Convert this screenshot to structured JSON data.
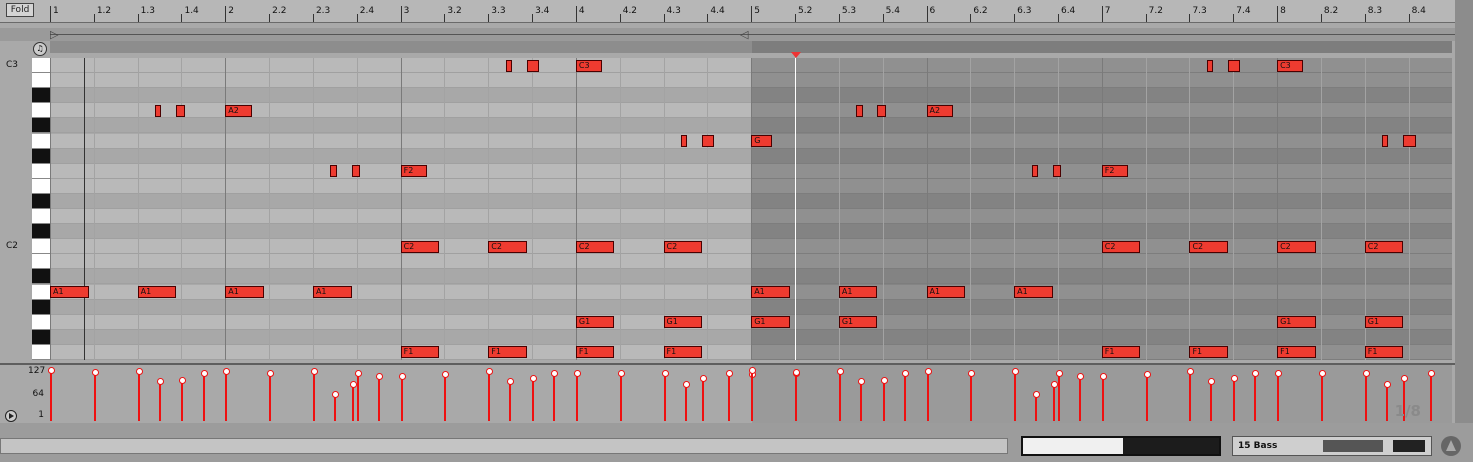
{
  "toolbar": {
    "fold_label": "Fold"
  },
  "ruler": {
    "labels": [
      "1",
      "1.2",
      "1.3",
      "1.4",
      "2",
      "2.2",
      "2.3",
      "2.4",
      "3",
      "3.2",
      "3.3",
      "3.4",
      "4",
      "4.2",
      "4.3",
      "4.4",
      "5",
      "5.2",
      "5.3",
      "5.4",
      "6",
      "6.2",
      "6.3",
      "6.4",
      "7",
      "7.2",
      "7.3",
      "7.4",
      "8",
      "8.2",
      "8.3",
      "8.4"
    ]
  },
  "piano": {
    "octave_labels": [
      "C3",
      "C2"
    ]
  },
  "velocity": {
    "axis_labels": [
      "127",
      "64",
      "1"
    ],
    "grid_label": "1/8"
  },
  "clip": {
    "playhead_beat": 4.25
  },
  "notes": [
    {
      "pitch": "C3",
      "beat": 2.6,
      "length": 0.035,
      "label": ""
    },
    {
      "pitch": "C3",
      "beat": 2.72,
      "length": 0.07,
      "label": ""
    },
    {
      "pitch": "C3",
      "beat": 3.0,
      "length": 0.15,
      "label": "C3"
    },
    {
      "pitch": "A2",
      "beat": 0.6,
      "length": 0.035,
      "label": ""
    },
    {
      "pitch": "A2",
      "beat": 0.72,
      "length": 0.05,
      "label": ""
    },
    {
      "pitch": "A2",
      "beat": 1.0,
      "length": 0.15,
      "label": "A2"
    },
    {
      "pitch": "G2",
      "beat": 3.6,
      "length": 0.035,
      "label": ""
    },
    {
      "pitch": "G2",
      "beat": 3.72,
      "length": 0.07,
      "label": ""
    },
    {
      "pitch": "G2",
      "beat": 4.0,
      "length": 0.12,
      "label": "G"
    },
    {
      "pitch": "F2",
      "beat": 1.6,
      "length": 0.035,
      "label": ""
    },
    {
      "pitch": "F2",
      "beat": 1.72,
      "length": 0.05,
      "label": ""
    },
    {
      "pitch": "F2",
      "beat": 2.0,
      "length": 0.15,
      "label": "F2"
    },
    {
      "pitch": "C2",
      "beat": 2.0,
      "length": 0.22,
      "label": "C2"
    },
    {
      "pitch": "C2",
      "beat": 2.5,
      "length": 0.22,
      "label": "C2"
    },
    {
      "pitch": "C2",
      "beat": 3.0,
      "length": 0.22,
      "label": "C2"
    },
    {
      "pitch": "C2",
      "beat": 3.5,
      "length": 0.22,
      "label": "C2"
    },
    {
      "pitch": "A1",
      "beat": 0.0,
      "length": 0.22,
      "label": "A1"
    },
    {
      "pitch": "A1",
      "beat": 0.5,
      "length": 0.22,
      "label": "A1"
    },
    {
      "pitch": "A1",
      "beat": 1.0,
      "length": 0.22,
      "label": "A1"
    },
    {
      "pitch": "A1",
      "beat": 1.5,
      "length": 0.22,
      "label": "A1"
    },
    {
      "pitch": "G1",
      "beat": 3.0,
      "length": 0.22,
      "label": "G1"
    },
    {
      "pitch": "G1",
      "beat": 3.5,
      "length": 0.22,
      "label": "G1"
    },
    {
      "pitch": "G1",
      "beat": 4.0,
      "length": 0.22,
      "label": "G1"
    },
    {
      "pitch": "G1",
      "beat": 4.5,
      "length": 0.22,
      "label": "G1"
    },
    {
      "pitch": "F1",
      "beat": 2.0,
      "length": 0.22,
      "label": "F1"
    },
    {
      "pitch": "F1",
      "beat": 2.5,
      "length": 0.22,
      "label": "F1"
    },
    {
      "pitch": "F1",
      "beat": 3.0,
      "length": 0.22,
      "label": "F1"
    },
    {
      "pitch": "F1",
      "beat": 3.5,
      "length": 0.22,
      "label": "F1"
    }
  ],
  "loop2_offset_beats": 4,
  "velocities": [
    {
      "beat": 0.0,
      "v": 124
    },
    {
      "beat": 0.25,
      "v": 120
    },
    {
      "beat": 0.5,
      "v": 121
    },
    {
      "beat": 0.62,
      "v": 96
    },
    {
      "beat": 0.75,
      "v": 100
    },
    {
      "beat": 0.87,
      "v": 118
    },
    {
      "beat": 1.0,
      "v": 122
    },
    {
      "beat": 1.25,
      "v": 117
    },
    {
      "beat": 1.5,
      "v": 122
    },
    {
      "beat": 1.75,
      "v": 117
    },
    {
      "beat": 1.62,
      "v": 64
    },
    {
      "beat": 1.72,
      "v": 88
    },
    {
      "beat": 1.87,
      "v": 108
    },
    {
      "beat": 2.0,
      "v": 110
    },
    {
      "beat": 2.25,
      "v": 114
    },
    {
      "beat": 2.5,
      "v": 123
    },
    {
      "beat": 2.62,
      "v": 96
    },
    {
      "beat": 2.75,
      "v": 104
    },
    {
      "beat": 2.87,
      "v": 116
    },
    {
      "beat": 3.0,
      "v": 116
    },
    {
      "beat": 3.25,
      "v": 118
    },
    {
      "beat": 3.5,
      "v": 118
    },
    {
      "beat": 3.62,
      "v": 90
    },
    {
      "beat": 3.72,
      "v": 104
    },
    {
      "beat": 3.87,
      "v": 117
    },
    {
      "beat": 4.0,
      "v": 114
    },
    {
      "beat": 4.25,
      "v": 116
    }
  ],
  "bottom": {
    "track_name": "15 Bass"
  }
}
